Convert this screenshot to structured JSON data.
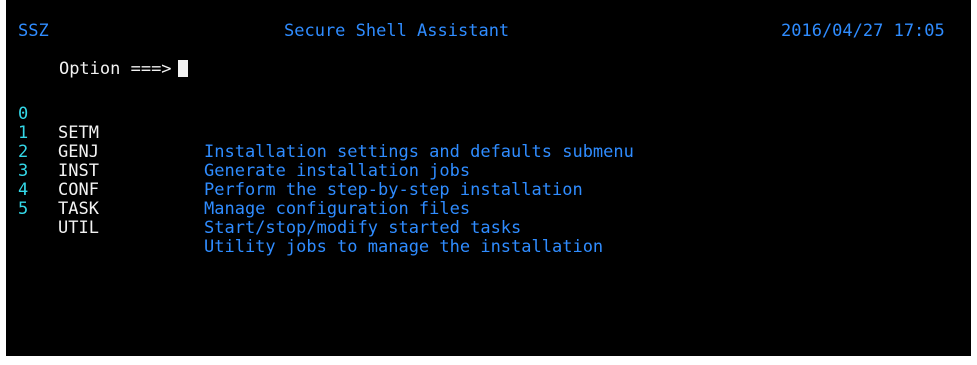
{
  "header": {
    "system_id": "SSZ",
    "title": "Secure Shell Assistant",
    "datetime": "2016/04/27 17:05"
  },
  "command_line": {
    "prompt": "Option ===>",
    "value": ""
  },
  "menu": {
    "items": [
      {
        "number": "0",
        "code": "SETM",
        "description": "Installation settings and defaults submenu"
      },
      {
        "number": "1",
        "code": "GENJ",
        "description": "Generate installation jobs"
      },
      {
        "number": "2",
        "code": "INST",
        "description": "Perform the step-by-step installation"
      },
      {
        "number": "3",
        "code": "CONF",
        "description": "Manage configuration files"
      },
      {
        "number": "4",
        "code": "TASK",
        "description": "Start/stop/modify started tasks"
      },
      {
        "number": "5",
        "code": "UTIL",
        "description": "Utility jobs to manage the installation"
      }
    ]
  },
  "colors": {
    "background": "#000000",
    "header_text": "#2f8cff",
    "option_text": "#f2f2f2",
    "menu_number": "#34d8e8",
    "menu_code": "#f2f2f2",
    "menu_description": "#2f8cff"
  }
}
